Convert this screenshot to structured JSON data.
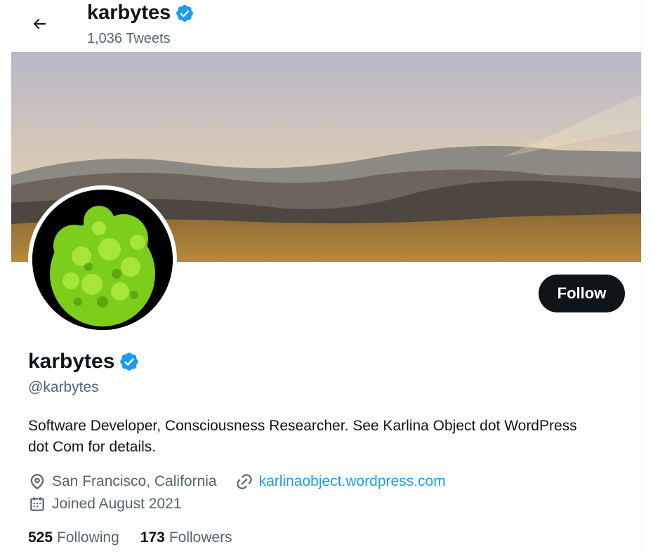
{
  "header": {
    "name": "karbytes",
    "tweet_count": "1,036 Tweets"
  },
  "profile": {
    "display_name": "karbytes",
    "handle": "@karbytes",
    "follow_label": "Follow",
    "bio": "Software Developer, Consciousness Researcher. See Karlina Object dot WordPress dot Com for details.",
    "location": "San Francisco, California",
    "website": "karlinaobject.wordpress.com",
    "joined": "Joined August 2021",
    "following_count": "525",
    "following_label": "Following",
    "followers_count": "173",
    "followers_label": "Followers"
  },
  "colors": {
    "accent": "#1d9bf0",
    "text": "#0f1419",
    "secondary": "#536471",
    "verified": "#1d9bf0"
  },
  "icons": [
    "back-arrow-icon",
    "verified-badge-icon",
    "location-pin-icon",
    "link-icon",
    "calendar-icon"
  ]
}
